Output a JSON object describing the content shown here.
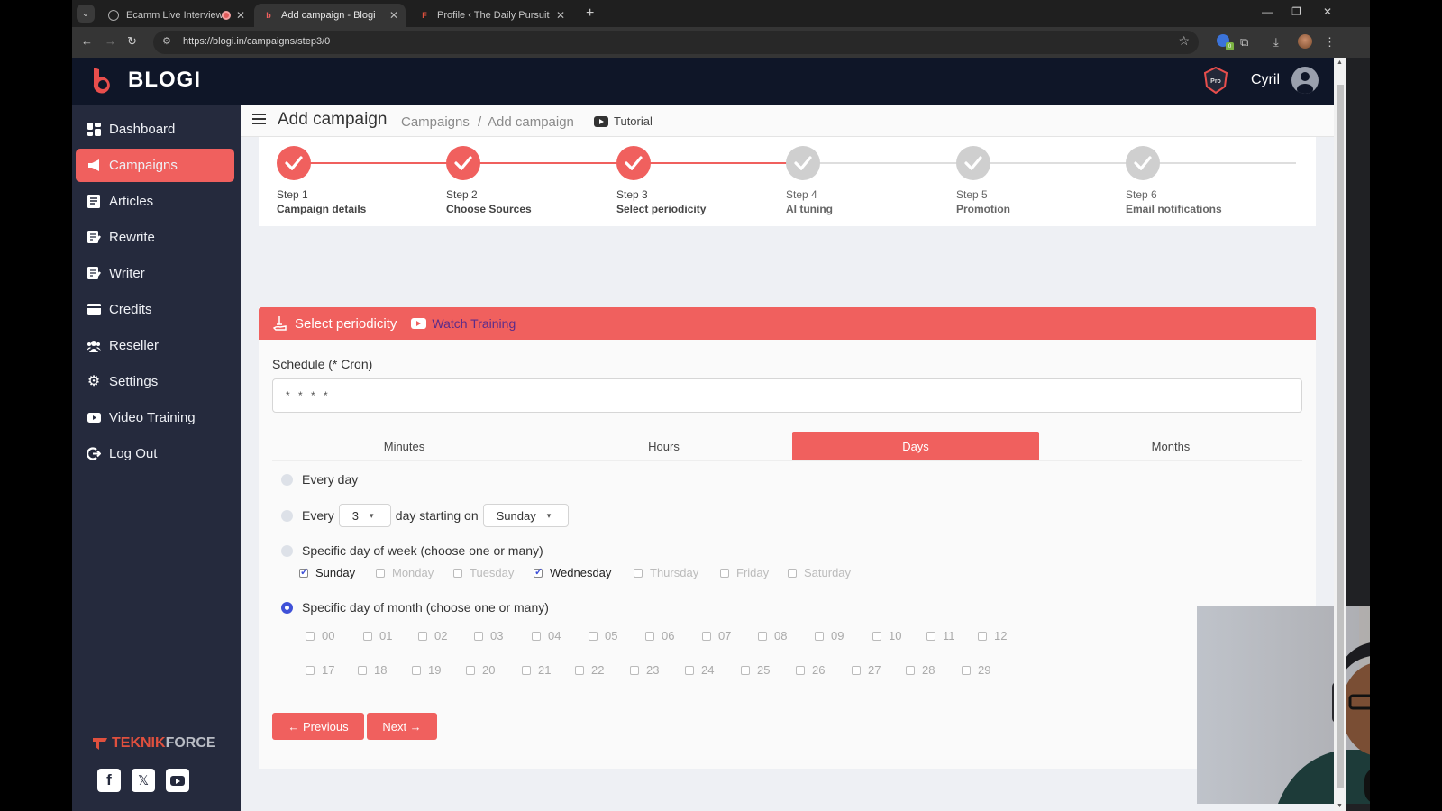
{
  "browser": {
    "tabs": [
      {
        "title": "Ecamm Live Interview",
        "recording": true,
        "active": false
      },
      {
        "title": "Add campaign - Blogi",
        "active": true
      },
      {
        "title": "Profile ‹ The Daily Pursuit — W",
        "active": false
      }
    ],
    "url": "https://blogi.in/campaigns/step3/0",
    "extension_badge": "0"
  },
  "app": {
    "brand": "BLOGI",
    "pro_badge": "Pro",
    "user_name": "Cyril"
  },
  "sidebar": {
    "items": [
      {
        "label": "Dashboard",
        "icon": "dashboard-icon",
        "active": false
      },
      {
        "label": "Campaigns",
        "icon": "megaphone-icon",
        "active": true
      },
      {
        "label": "Articles",
        "icon": "article-icon",
        "active": false
      },
      {
        "label": "Rewrite",
        "icon": "edit-icon",
        "active": false
      },
      {
        "label": "Writer",
        "icon": "edit-icon",
        "active": false
      },
      {
        "label": "Credits",
        "icon": "credit-card-icon",
        "active": false
      },
      {
        "label": "Reseller",
        "icon": "users-icon",
        "active": false
      },
      {
        "label": "Settings",
        "icon": "gear-icon",
        "active": false
      },
      {
        "label": "Video Training",
        "icon": "video-icon",
        "active": false
      },
      {
        "label": "Log Out",
        "icon": "logout-icon",
        "active": false
      }
    ],
    "footer_brand_red": "TEKNIK",
    "footer_brand_gray": "FORCE",
    "social": [
      "facebook-icon",
      "x-icon",
      "youtube-icon"
    ]
  },
  "header": {
    "title": "Add campaign",
    "breadcrumb": [
      "Campaigns",
      "Add campaign"
    ],
    "breadcrumb_sep": "/",
    "tutorial_label": "Tutorial"
  },
  "steps": [
    {
      "num": "Step 1",
      "label": "Campaign details",
      "done": true
    },
    {
      "num": "Step 2",
      "label": "Choose Sources",
      "done": true
    },
    {
      "num": "Step 3",
      "label": "Select periodicity",
      "done": true
    },
    {
      "num": "Step 4",
      "label": "AI tuning",
      "done": false
    },
    {
      "num": "Step 5",
      "label": "Promotion",
      "done": false
    },
    {
      "num": "Step 6",
      "label": "Email notifications",
      "done": false
    }
  ],
  "card": {
    "title": "Select periodicity",
    "watch_training": "Watch Training",
    "schedule_label": "Schedule (* Cron)",
    "schedule_value": "* * * *",
    "tabs": [
      {
        "label": "Minutes",
        "active": false
      },
      {
        "label": "Hours",
        "active": false
      },
      {
        "label": "Days",
        "active": true
      },
      {
        "label": "Months",
        "active": false
      }
    ],
    "options": {
      "every_day": "Every day",
      "every_prefix": "Every",
      "every_n_value": "3",
      "every_mid": "day starting on",
      "start_day_value": "Sunday",
      "specific_week": "Specific day of week (choose one or many)",
      "specific_month": "Specific day of month (choose one or many)",
      "selected": "specific_month"
    },
    "weekdays": [
      {
        "label": "Sunday",
        "checked": true
      },
      {
        "label": "Monday",
        "checked": false
      },
      {
        "label": "Tuesday",
        "checked": false
      },
      {
        "label": "Wednesday",
        "checked": true
      },
      {
        "label": "Thursday",
        "checked": false
      },
      {
        "label": "Friday",
        "checked": false
      },
      {
        "label": "Saturday",
        "checked": false
      }
    ],
    "month_days_row1": [
      "00",
      "01",
      "02",
      "03",
      "04",
      "05",
      "06",
      "07",
      "08",
      "09",
      "10",
      "11",
      "12"
    ],
    "month_days_row2": [
      "17",
      "18",
      "19",
      "20",
      "21",
      "22",
      "23",
      "24",
      "25",
      "26",
      "27",
      "28",
      "29"
    ],
    "prev_label": "← Previous",
    "next_label": "Next →"
  },
  "colors": {
    "accent": "#f0605e",
    "sidebar_bg": "#252a3d",
    "appbar_bg": "#0f1628",
    "radio_selected": "#3f51d8"
  }
}
